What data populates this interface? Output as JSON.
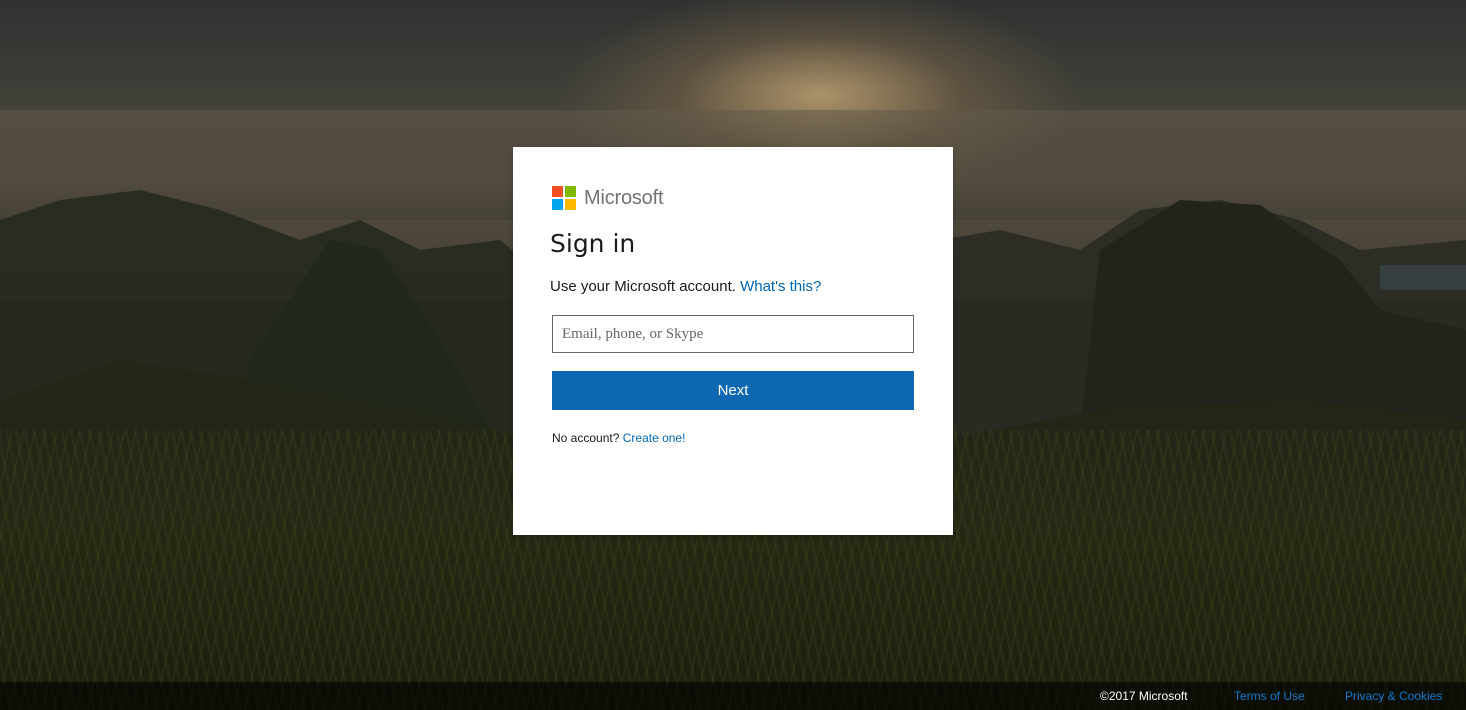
{
  "brand": {
    "name": "Microsoft",
    "logo_colors": [
      "#f25022",
      "#7fba00",
      "#00a4ef",
      "#ffb900"
    ]
  },
  "signin": {
    "title": "Sign in",
    "subtitle_text": "Use your Microsoft account.",
    "whats_this_link": "What's this?",
    "email_placeholder": "Email, phone, or Skype",
    "email_value": "",
    "next_label": "Next",
    "no_account_text": "No account?",
    "create_link": "Create one!"
  },
  "footer": {
    "copyright": "©2017 Microsoft",
    "terms": "Terms of Use",
    "privacy": "Privacy & Cookies"
  },
  "colors": {
    "accent": "#0067b8",
    "button": "#0e67b3"
  }
}
